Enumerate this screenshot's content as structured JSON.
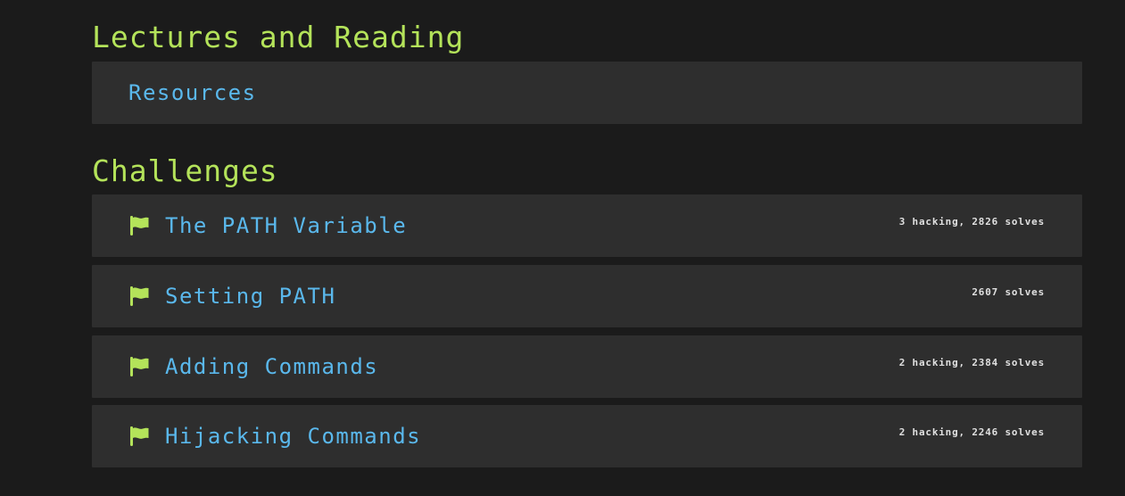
{
  "lectures": {
    "title": "Lectures and Reading",
    "items": [
      {
        "label": "Resources"
      }
    ]
  },
  "challenges": {
    "title": "Challenges",
    "items": [
      {
        "label": "The PATH Variable",
        "stats": "3 hacking, 2826 solves",
        "icon": "flag-icon"
      },
      {
        "label": "Setting PATH",
        "stats": "2607 solves",
        "icon": "flag-icon"
      },
      {
        "label": "Adding Commands",
        "stats": "2 hacking, 2384 solves",
        "icon": "flag-icon"
      },
      {
        "label": "Hijacking Commands",
        "stats": "2 hacking, 2246 solves",
        "icon": "flag-icon"
      }
    ]
  },
  "colors": {
    "background": "#1b1b1b",
    "card": "#2e2e2e",
    "heading": "#b4e35a",
    "link": "#5ab8ec",
    "flag": "#b4e35a",
    "stats": "#e0e0e0"
  }
}
